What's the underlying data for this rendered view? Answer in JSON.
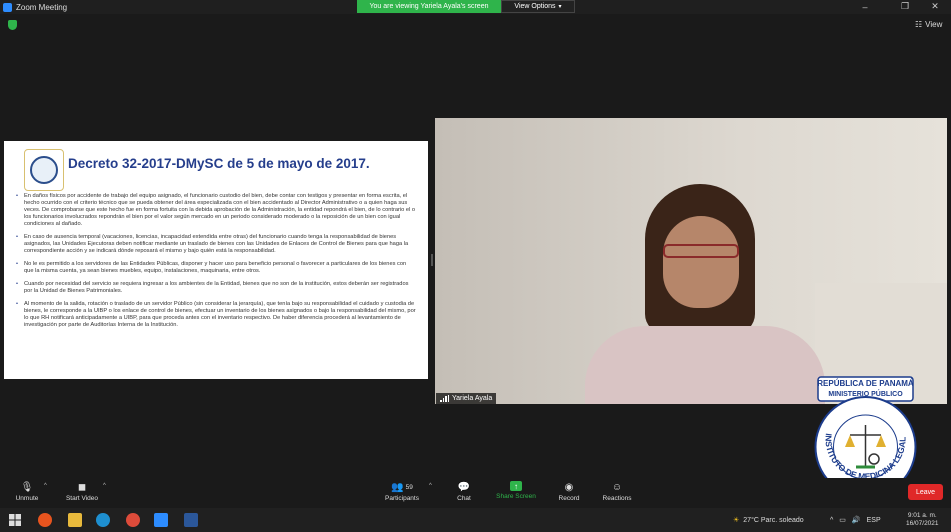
{
  "window": {
    "title": "Zoom Meeting"
  },
  "banner": {
    "viewing": "You are viewing Yariela Ayala's screen",
    "view_options": "View Options"
  },
  "top_right": {
    "view_label": "View"
  },
  "slide": {
    "title": "Decreto 32-2017-DMySC de  5 de mayo de 2017.",
    "bullets": [
      "En daños físicos por accidente de trabajo del equipo asignado, el funcionario custodio del bien, debe contar con testigos y presentar en forma escrita, el hecho ocurrido con el criterio técnico que se pueda obtener del área especializada con el bien accidentado al Director Administrativo o a quien haga sus veces. De comprobarse que este hecho fue en forma fortuita con la debida aprobación de la Administración, la entidad repondrá el bien, de lo contrario el o los funcionarios involucrados repondrán el bien por el valor según mercado en un periodo considerado moderado o la reposición de un bien con igual condiciones al dañado.",
      "En caso de ausencia temporal (vacaciones, licencias, incapacidad extendida entre otras) del funcionario cuando tenga la responsabilidad de bienes asignados, las Unidades Ejecutoras deben notificar mediante un traslado de bienes con las Unidades de Enlaces de Control de Bienes para que haga la correspondiente acción y se indicará dónde reposará el mismo y bajo quién está la responsabilidad.",
      "No le es permitido a los servidores de las Entidades Públicas, disponer y hacer uso para beneficio personal o favorecer a particulares de los bienes con que la misma cuenta, ya sean bienes muebles, equipo, instalaciones, maquinaria, entre otros.",
      "Cuando por necesidad del servicio se requiera ingresar a los ambientes de la Entidad, bienes que no son de la institución, estos deberán ser registrados por la Unidad de Bienes Patrimoniales.",
      "Al momento de la salida, rotación o traslado de un servidor Público (sin considerar la jerarquía), que tenía bajo su responsabilidad el cuidado y custodia de bienes, le corresponde a la UIBP o los enlace de control de bienes, efectuar un inventario de los bienes asignados o bajo la responsabilidad del mismo, por lo que RH notificará anticipadamente a UIBP, para que proceda antes con el inventario respectivo. De haber diferencia procederá al levantamiento de investigación por parte de Auditorías Interna de la Institución."
    ]
  },
  "video": {
    "participant_name": "Yariela Ayala"
  },
  "seal": {
    "line1": "REPÚBLICA DE PANAMÁ",
    "line2": "MINISTERIO PÚBLICO",
    "arc": "INSTITUTO DE MEDICINA LEGAL Y CIENCIAS FORENSES"
  },
  "toolbar": {
    "unmute": "Unmute",
    "start_video": "Start Video",
    "participants": "Participants",
    "participants_count": "59",
    "chat": "Chat",
    "share_screen": "Share Screen",
    "record": "Record",
    "reactions": "Reactions",
    "leave": "Leave"
  },
  "taskbar": {
    "weather": "27°C  Parc. soleado",
    "language": "ESP",
    "time": "9:01 a. m.",
    "date": "16/07/2021"
  },
  "colors": {
    "share_green": "#2fb44b",
    "leave_red": "#e02828",
    "slide_title": "#253e8c"
  }
}
